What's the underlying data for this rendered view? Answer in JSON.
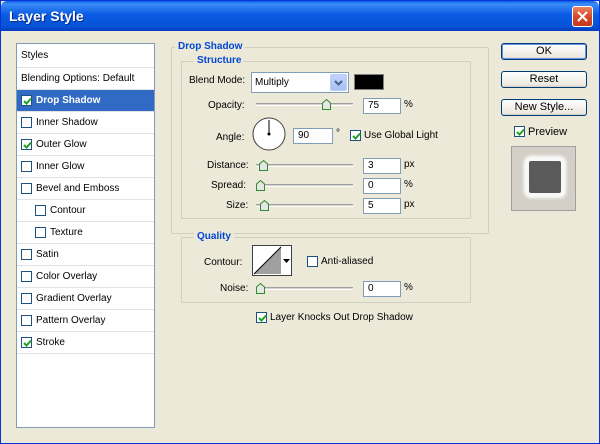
{
  "window": {
    "title": "Layer Style"
  },
  "styles_list": {
    "header": "Styles",
    "blending": "Blending Options: Default",
    "items": [
      {
        "label": "Drop Shadow",
        "checked": true,
        "selected": true
      },
      {
        "label": "Inner Shadow",
        "checked": false
      },
      {
        "label": "Outer Glow",
        "checked": true
      },
      {
        "label": "Inner Glow",
        "checked": false
      },
      {
        "label": "Bevel and Emboss",
        "checked": false
      },
      {
        "label": "Contour",
        "checked": false,
        "indent": true
      },
      {
        "label": "Texture",
        "checked": false,
        "indent": true
      },
      {
        "label": "Satin",
        "checked": false
      },
      {
        "label": "Color Overlay",
        "checked": false
      },
      {
        "label": "Gradient Overlay",
        "checked": false
      },
      {
        "label": "Pattern Overlay",
        "checked": false
      },
      {
        "label": "Stroke",
        "checked": true
      }
    ]
  },
  "drop_shadow": {
    "group_title": "Drop Shadow",
    "structure_title": "Structure",
    "blend_mode": {
      "label": "Blend Mode:",
      "value": "Multiply",
      "swatch_color": "#000000"
    },
    "opacity": {
      "label": "Opacity:",
      "value": "75",
      "unit": "%",
      "level": 0.75
    },
    "angle": {
      "label": "Angle:",
      "value": "90",
      "unit": "°",
      "use_global_light": "Use Global Light",
      "global_checked": true
    },
    "distance": {
      "label": "Distance:",
      "value": "3",
      "unit": "px",
      "level": 0.03
    },
    "spread": {
      "label": "Spread:",
      "value": "0",
      "unit": "%",
      "level": 0
    },
    "size": {
      "label": "Size:",
      "value": "5",
      "unit": "px",
      "level": 0.05
    }
  },
  "quality": {
    "group_title": "Quality",
    "contour_label": "Contour:",
    "anti_aliased": "Anti-aliased",
    "anti_aliased_checked": false,
    "noise": {
      "label": "Noise:",
      "value": "0",
      "unit": "%",
      "level": 0
    },
    "knocks_out": "Layer Knocks Out Drop Shadow",
    "knocks_out_checked": true
  },
  "buttons": {
    "ok": "OK",
    "reset": "Reset",
    "new_style": "New Style..."
  },
  "preview": {
    "label": "Preview",
    "checked": true
  },
  "colors": {
    "accent": "#0046d5",
    "selection": "#316ac5",
    "title_bar": "#0b5ce4"
  }
}
